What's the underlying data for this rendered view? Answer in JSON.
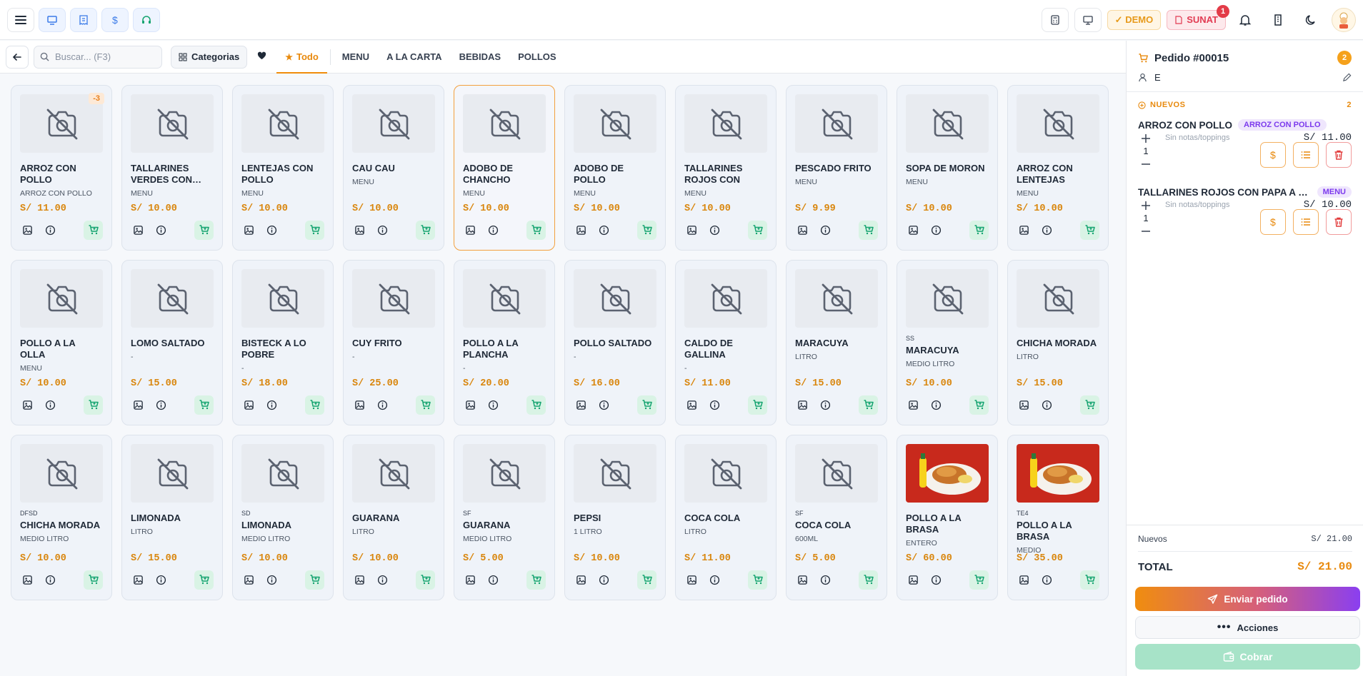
{
  "search": {
    "placeholder": "Buscar... (F3)"
  },
  "filters": {
    "categories_label": "Categorias",
    "tabs": [
      "Todo",
      "MENU",
      "A LA CARTA",
      "BEBIDAS",
      "POLLOS"
    ]
  },
  "topbar": {
    "demo_label": "DEMO",
    "sunat_label": "SUNAT",
    "sunat_count": "1"
  },
  "colors": {
    "accent": "#f08c0a",
    "cart_bg": "#d9f3e5",
    "tag": "#7c3aed",
    "pay_bg": "#a7e3c8"
  },
  "products": [
    {
      "code": "",
      "name": "ARROZ CON POLLO",
      "sub": "ARROZ CON POLLO",
      "price": "S/ 11.00",
      "stock": "-3",
      "photo": false,
      "selected": false
    },
    {
      "code": "",
      "name": "TALLARINES VERDES CON…",
      "sub": "MENU",
      "price": "S/ 10.00",
      "photo": false
    },
    {
      "code": "",
      "name": "LENTEJAS CON POLLO",
      "sub": "MENU",
      "price": "S/ 10.00",
      "photo": false
    },
    {
      "code": "",
      "name": "CAU CAU",
      "sub": "MENU",
      "price": "S/ 10.00",
      "photo": false
    },
    {
      "code": "",
      "name": "ADOBO DE CHANCHO",
      "sub": "MENU",
      "price": "S/ 10.00",
      "photo": false,
      "selected": true
    },
    {
      "code": "",
      "name": "ADOBO DE POLLO",
      "sub": "MENU",
      "price": "S/ 10.00",
      "photo": false
    },
    {
      "code": "",
      "name": "TALLARINES ROJOS CON PAP…",
      "sub": "MENU",
      "price": "S/ 10.00",
      "photo": false
    },
    {
      "code": "",
      "name": "PESCADO FRITO",
      "sub": "MENU",
      "price": "S/ 9.99",
      "photo": false
    },
    {
      "code": "",
      "name": "SOPA DE MORON",
      "sub": "MENU",
      "price": "S/ 10.00",
      "photo": false
    },
    {
      "code": "",
      "name": "ARROZ CON LENTEJAS",
      "sub": "MENU",
      "price": "S/ 10.00",
      "photo": false
    },
    {
      "code": "",
      "name": "POLLO A LA OLLA",
      "sub": "MENU",
      "price": "S/ 10.00",
      "photo": false
    },
    {
      "code": "",
      "name": "LOMO SALTADO",
      "sub": "-",
      "price": "S/ 15.00",
      "photo": false
    },
    {
      "code": "",
      "name": "BISTECK A LO POBRE",
      "sub": "-",
      "price": "S/ 18.00",
      "photo": false
    },
    {
      "code": "",
      "name": "CUY FRITO",
      "sub": "-",
      "price": "S/ 25.00",
      "photo": false
    },
    {
      "code": "",
      "name": "POLLO A LA PLANCHA",
      "sub": "-",
      "price": "S/ 20.00",
      "photo": false
    },
    {
      "code": "",
      "name": "POLLO SALTADO",
      "sub": "-",
      "price": "S/ 16.00",
      "photo": false
    },
    {
      "code": "",
      "name": "CALDO DE GALLINA",
      "sub": "-",
      "price": "S/ 11.00",
      "photo": false
    },
    {
      "code": "",
      "name": "MARACUYA",
      "sub": "LITRO",
      "price": "S/ 15.00",
      "photo": false
    },
    {
      "code": "SS",
      "name": "MARACUYA",
      "sub": "MEDIO LITRO",
      "price": "S/ 10.00",
      "photo": false
    },
    {
      "code": "",
      "name": "CHICHA MORADA",
      "sub": "LITRO",
      "price": "S/ 15.00",
      "photo": false
    },
    {
      "code": "DFSD",
      "name": "CHICHA MORADA",
      "sub": "MEDIO LITRO",
      "price": "S/ 10.00",
      "photo": false
    },
    {
      "code": "",
      "name": "LIMONADA",
      "sub": "LITRO",
      "price": "S/ 15.00",
      "photo": false
    },
    {
      "code": "SD",
      "name": "LIMONADA",
      "sub": "MEDIO LITRO",
      "price": "S/ 10.00",
      "photo": false
    },
    {
      "code": "",
      "name": "GUARANA",
      "sub": "LITRO",
      "price": "S/ 10.00",
      "photo": false
    },
    {
      "code": "SF",
      "name": "GUARANA",
      "sub": "MEDIO LITRO",
      "price": "S/ 5.00",
      "photo": false
    },
    {
      "code": "",
      "name": "PEPSI",
      "sub": "1 LITRO",
      "price": "S/ 10.00",
      "photo": false
    },
    {
      "code": "",
      "name": "COCA COLA",
      "sub": "LITRO",
      "price": "S/ 11.00",
      "photo": false
    },
    {
      "code": "SF",
      "name": "COCA COLA",
      "sub": "600ML",
      "price": "S/ 5.00",
      "photo": false
    },
    {
      "code": "",
      "name": "POLLO A LA BRASA",
      "sub": "ENTERO",
      "price": "S/ 60.00",
      "photo": true
    },
    {
      "code": "TE4",
      "name": "POLLO A LA BRASA",
      "sub": "MEDIO",
      "price": "S/ 35.00",
      "photo": true
    }
  ],
  "order": {
    "title": "Pedido #00015",
    "count": "2",
    "client": "E",
    "section_label": "NUEVOS",
    "section_count": "2",
    "items": [
      {
        "name": "ARROZ CON POLLO",
        "tag": "ARROZ CON POLLO",
        "qty": "1",
        "notes": "Sin notas/toppings",
        "price": "S/ 11.00"
      },
      {
        "name": "TALLARINES ROJOS CON PAPA A LA …",
        "tag": "MENU",
        "qty": "1",
        "notes": "Sin notas/toppings",
        "price": "S/ 10.00"
      }
    ],
    "subtotal_label": "Nuevos",
    "subtotal_value": "S/ 21.00",
    "total_label": "TOTAL",
    "total_value": "S/ 21.00",
    "send_label": "Enviar pedido",
    "actions_label": "Acciones",
    "pay_label": "Cobrar"
  }
}
